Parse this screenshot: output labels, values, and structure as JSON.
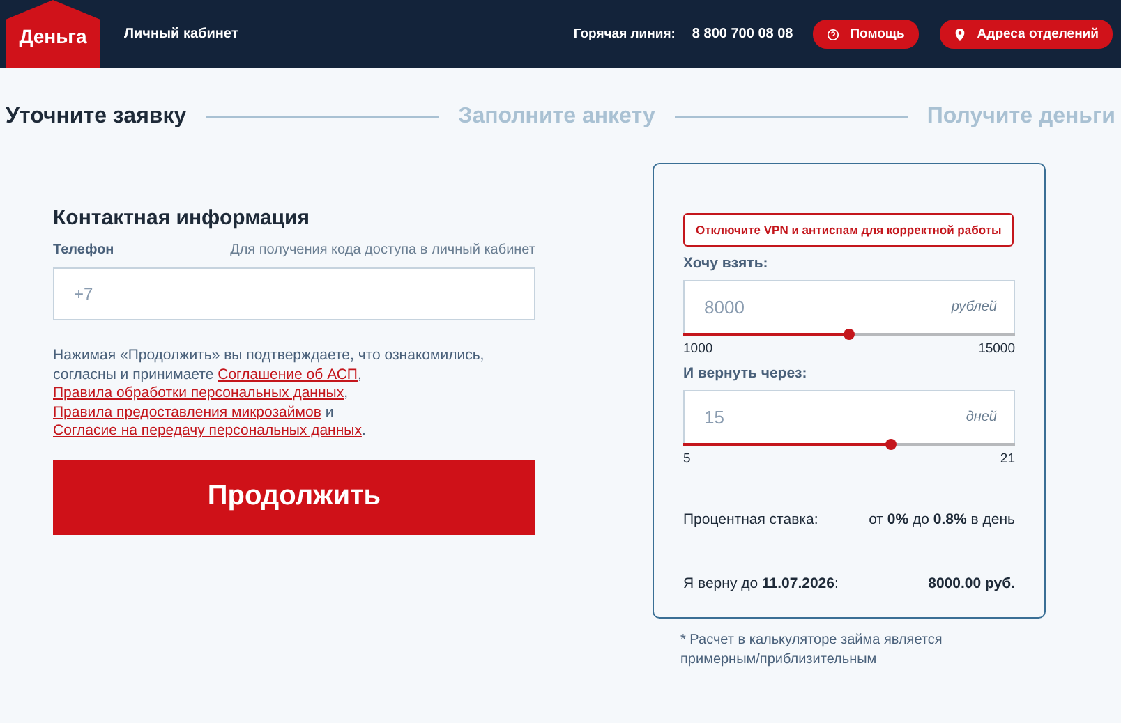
{
  "header": {
    "logo": "Деньга",
    "cabinet_link": "Личный кабинет",
    "hotline_label": "Горячая линия:",
    "hotline_phone": "8 800 700 08 08",
    "buttons": [
      {
        "kind": "help",
        "label": "Помощь"
      },
      {
        "kind": "location",
        "label": "Адреса отделений"
      }
    ]
  },
  "steps": [
    {
      "label": "Уточните заявку",
      "selected": true
    },
    {
      "label": "Заполните анкету",
      "selected": false
    },
    {
      "label": "Получите деньги",
      "selected": false
    }
  ],
  "contact": {
    "title": "Контактная информация",
    "phone_label": "Телефон",
    "phone_hint": "Для получения кода доступа в личный кабинет",
    "phone_placeholder": "+7",
    "consent": [
      {
        "kind": "text",
        "text": "Нажимая «Продолжить» вы подтверждаете, что ознакомились, согласны и принимаете "
      },
      {
        "kind": "link",
        "text": "Соглашение об АСП"
      },
      {
        "kind": "text",
        "text": ", "
      },
      {
        "kind": "link",
        "text": "Правила обработки персональных данных"
      },
      {
        "kind": "text",
        "text": ", "
      },
      {
        "kind": "link",
        "text": "Правила предоставления микрозаймов"
      },
      {
        "kind": "text",
        "text": " и "
      },
      {
        "kind": "link",
        "text": "Согласие на передачу персональных данных"
      },
      {
        "kind": "text",
        "text": "."
      }
    ],
    "submit": "Продолжить"
  },
  "calculator": {
    "warning": "Отключите VPN и антиспам для корректной работы",
    "sliders": [
      {
        "label": "Хочу взять:",
        "value": "8000",
        "unit": "рублей",
        "min": "1000",
        "max": "15000",
        "level": 0.5
      },
      {
        "label": "И вернуть через:",
        "value": "15",
        "unit": "дней",
        "min": "5",
        "max": "21",
        "level": 0.625
      }
    ],
    "rate_label": "Процентная ставка:",
    "rate_value": "от **0%** до **0.8%** в день",
    "return_label": "Я верну до **11.07.2026**:",
    "return_value": "8000.00 руб.",
    "note": "* Расчет в калькуляторе займа является примерным/приблизительным"
  }
}
